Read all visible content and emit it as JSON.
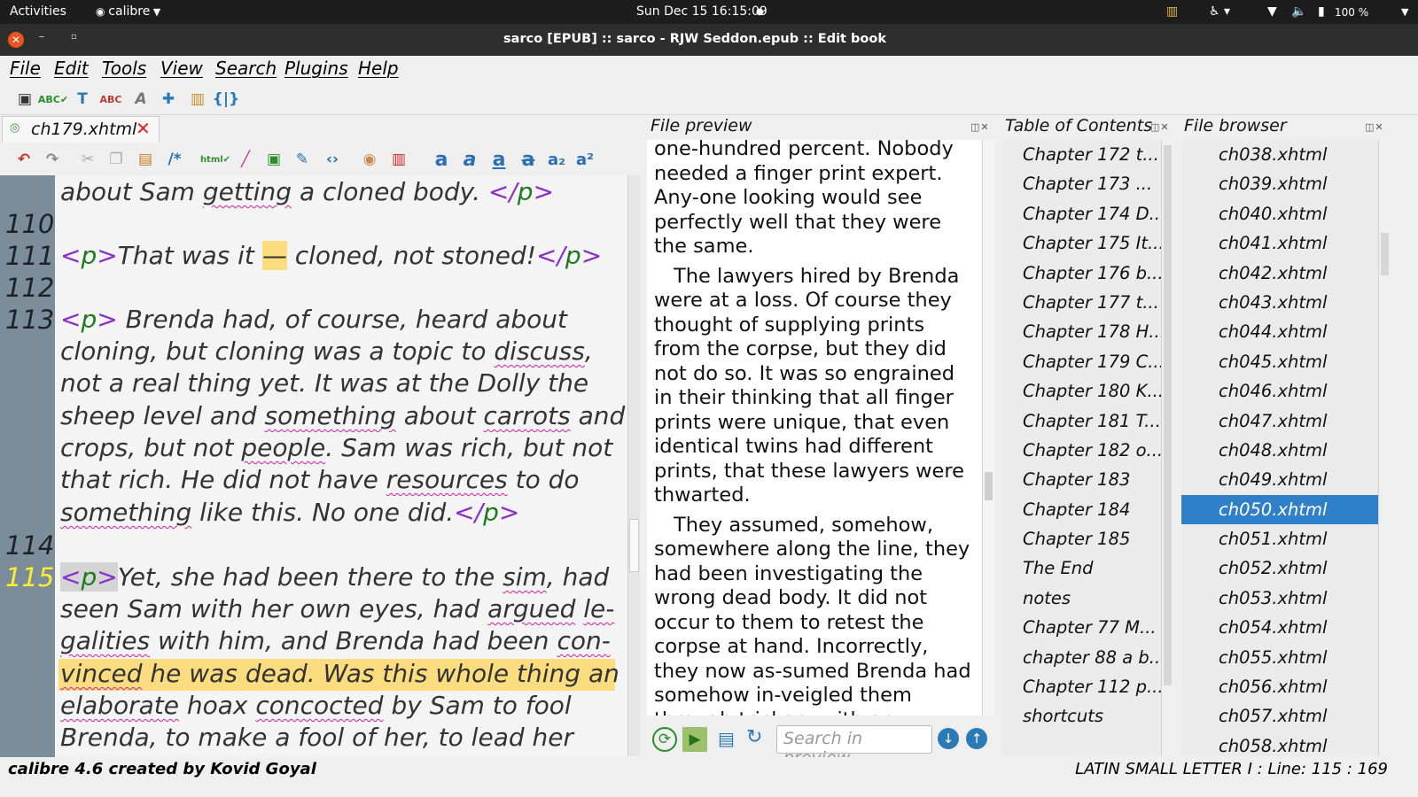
{
  "system": {
    "activities": "Activities",
    "app_name": "calibre",
    "datetime": "Sun Dec 15  16:15:09",
    "battery": "100 %"
  },
  "window": {
    "title": "sarco [EPUB] :: sarco - RJW Seddon.epub :: Edit book"
  },
  "menu": {
    "file": "File",
    "edit": "Edit",
    "tools": "Tools",
    "view": "View",
    "search": "Search",
    "plugins": "Plugins",
    "help": "Help"
  },
  "editor": {
    "tab_label": "ch179.xhtml",
    "line_numbers": {
      "l110": "110",
      "l111": "111",
      "l112": "112",
      "l113": "113",
      "l114": "114",
      "l115": "115"
    },
    "lines": {
      "a1": "about Sam",
      "a2": "getting",
      "a3": "a cloned body.",
      "b1": "That was it",
      "b2": "—",
      "b3": "cloned, not stoned!",
      "c1": "Brenda had, of course, heard about",
      "c2": "cloning, but cloning was a topic to",
      "c3": "discuss",
      "c4": ",",
      "d1": "not a real thing yet. It was at the Dolly the",
      "e1": "sheep level and",
      "e2": "something",
      "e3": "about",
      "e4": "carrots",
      "e5": "and",
      "f1": "crops, but not",
      "f2": "people",
      "f3": ". Sam was rich, but not",
      "g1": "that rich. He did not have",
      "g2": "resources",
      "g3": "to do",
      "h1": "something",
      "h2": "like this. No one did.",
      "i1": "Yet, she had been there to the",
      "i2": "sim",
      "i3": ", had",
      "j1": "seen Sam with her own eyes, had",
      "j2": "argued",
      "j3": "le-",
      "k1": "galities",
      "k2": "with him, and Brenda had been",
      "k3": "con-",
      "l1": "vinced",
      "l2": "he was dead. Was this whole thing an",
      "m1": "elaborate",
      "m2": "hoax",
      "m3": "concocted",
      "m4": "by Sam to fool",
      "n1": "Brenda, to make a fool of her, to lead her"
    },
    "tags": {
      "p_open": "p",
      "p_close": "p",
      "lt": "<",
      "gt": ">",
      "lts": "</"
    }
  },
  "preview": {
    "title": "File preview",
    "p1": "one-hundred percent. Nobody needed a finger print expert. Any-one looking would see perfectly well that they were the same.",
    "p2": "The lawyers hired by Brenda were at a loss. Of course they thought of supplying prints from the corpse, but they did not do so. It was so engrained in their thinking that all finger prints were unique, that even identical twins had different prints, that these lawyers were thwarted.",
    "p3": "They assumed, somehow, somewhere along the line, they had been investigating the wrong dead body. It did not occur to them to retest the corpse at hand. Incorrectly, they now as-sumed Brenda had somehow in-veigled them through trickery with an attempt to gain the legacy. Secretly, they now began",
    "search_placeholder": "Search in preview"
  },
  "toc": {
    "title": "Table of Contents",
    "items": [
      "Chapter 172 t...",
      "Chapter 173 ...",
      "Chapter 174 D...",
      "Chapter 175 It...",
      "Chapter 176 b...",
      "Chapter 177 t...",
      "Chapter 178 H...",
      "Chapter 179 C...",
      "Chapter 180 K...",
      "Chapter 181 T...",
      "Chapter 182 o...",
      "Chapter 183",
      "Chapter 184",
      "Chapter 185",
      "The End",
      "notes",
      "Chapter 77 M...",
      "chapter 88 a b...",
      "Chapter 112 p...",
      "shortcuts"
    ]
  },
  "file_browser": {
    "title": "File browser",
    "items": [
      "ch038.xhtml",
      "ch039.xhtml",
      "ch040.xhtml",
      "ch041.xhtml",
      "ch042.xhtml",
      "ch043.xhtml",
      "ch044.xhtml",
      "ch045.xhtml",
      "ch046.xhtml",
      "ch047.xhtml",
      "ch048.xhtml",
      "ch049.xhtml",
      "ch050.xhtml",
      "ch051.xhtml",
      "ch052.xhtml",
      "ch053.xhtml",
      "ch054.xhtml",
      "ch055.xhtml",
      "ch056.xhtml",
      "ch057.xhtml",
      "ch058.xhtml"
    ],
    "selected": "ch050.xhtml"
  },
  "status": {
    "left": "calibre 4.6 created by Kovid Goyal",
    "right": "LATIN SMALL LETTER I : Line: 115 : 169"
  },
  "colors": {
    "gutter": "#7b8d9b",
    "current_line_number": "#ffef2a",
    "highlight": "#fbdc7f",
    "selection": "#2f80c9",
    "tag": "#8b2fc9",
    "tag_name": "#1f7a1f"
  }
}
